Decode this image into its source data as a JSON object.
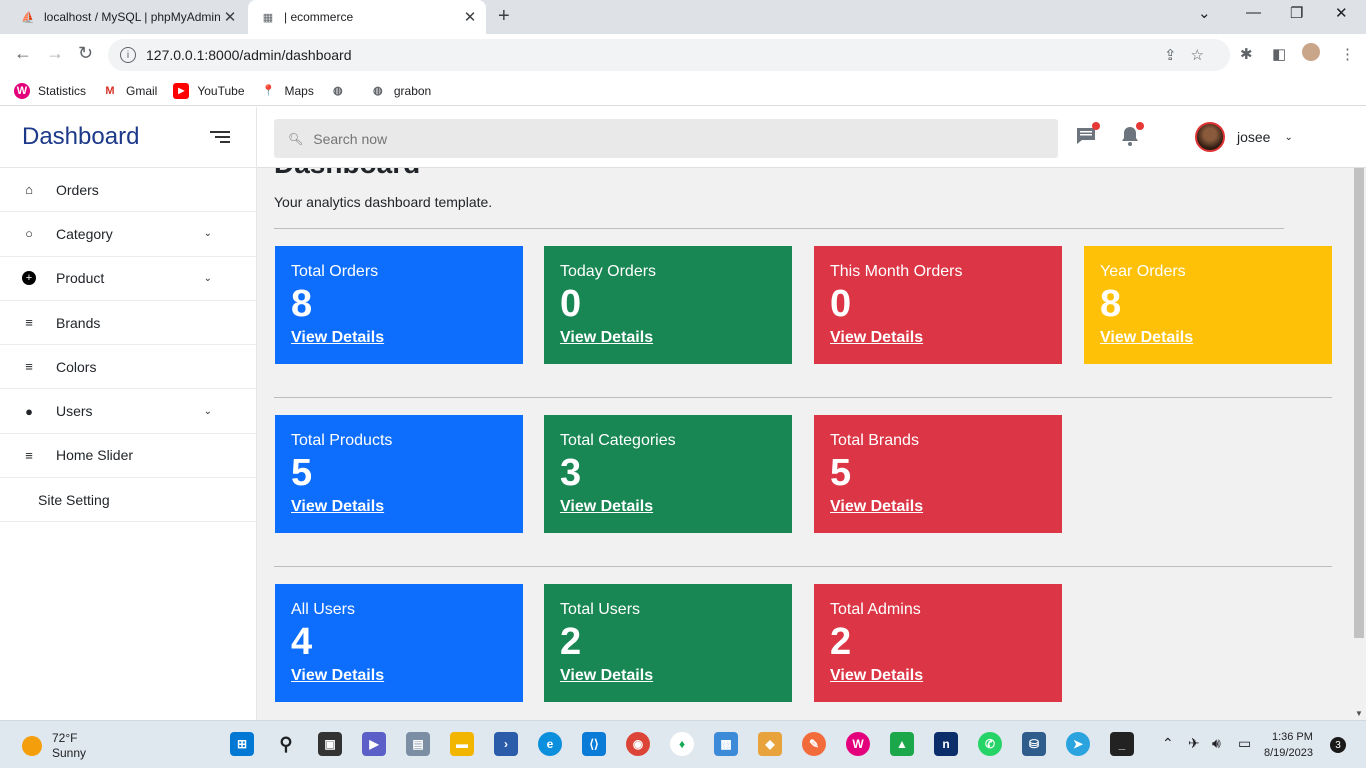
{
  "browser": {
    "tabs": [
      {
        "title": "localhost / MySQL | phpMyAdmin"
      },
      {
        "title": "| ecommerce"
      }
    ],
    "url": "127.0.0.1:8000/admin/dashboard",
    "bookmarks": [
      {
        "label": "Statistics",
        "icon": "wamp-icon"
      },
      {
        "label": "Gmail",
        "icon": "gmail-icon"
      },
      {
        "label": "YouTube",
        "icon": "youtube-icon"
      },
      {
        "label": "Maps",
        "icon": "maps-icon"
      },
      {
        "label": "",
        "icon": "globe-icon"
      },
      {
        "label": "grabon",
        "icon": "globe-icon"
      }
    ]
  },
  "sidebar": {
    "title": "Dashboard",
    "items": [
      {
        "label": "Orders",
        "icon": "home-icon",
        "expandable": false
      },
      {
        "label": "Category",
        "icon": "circle-icon",
        "expandable": true
      },
      {
        "label": "Product",
        "icon": "plus-circle-icon",
        "expandable": true
      },
      {
        "label": "Brands",
        "icon": "list-icon",
        "expandable": false
      },
      {
        "label": "Colors",
        "icon": "list-icon",
        "expandable": false
      },
      {
        "label": "Users",
        "icon": "person-icon",
        "expandable": true
      },
      {
        "label": "Home Slider",
        "icon": "list-icon",
        "expandable": false
      },
      {
        "label": "Site Setting",
        "icon": "",
        "expandable": false
      }
    ]
  },
  "topbar": {
    "search_placeholder": "Search now",
    "username": "josee"
  },
  "main": {
    "heading": "Dashboard",
    "subtitle": "Your analytics dashboard template.",
    "details_label": "View Details",
    "rows": [
      [
        {
          "label": "Total Orders",
          "value": "8",
          "color": "#0d6efd"
        },
        {
          "label": "Today Orders",
          "value": "0",
          "color": "#198754"
        },
        {
          "label": "This Month Orders",
          "value": "0",
          "color": "#dc3545"
        },
        {
          "label": "Year Orders",
          "value": "8",
          "color": "#ffc107"
        }
      ],
      [
        {
          "label": "Total Products",
          "value": "5",
          "color": "#0d6efd"
        },
        {
          "label": "Total Categories",
          "value": "3",
          "color": "#198754"
        },
        {
          "label": "Total Brands",
          "value": "5",
          "color": "#dc3545"
        }
      ],
      [
        {
          "label": "All Users",
          "value": "4",
          "color": "#0d6efd"
        },
        {
          "label": "Total Users",
          "value": "2",
          "color": "#198754"
        },
        {
          "label": "Total Admins",
          "value": "2",
          "color": "#dc3545"
        }
      ]
    ]
  },
  "taskbar": {
    "weather_temp": "72°F",
    "weather_desc": "Sunny",
    "time": "1:36 PM",
    "date": "8/19/2023",
    "notifications": "3"
  }
}
